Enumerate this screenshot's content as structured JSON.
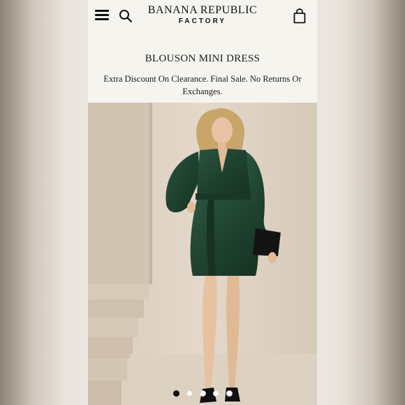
{
  "header": {
    "brand_line1": "BANANA REPUBLIC",
    "brand_line2": "FACTORY",
    "menu_icon": "hamburger-menu-icon",
    "search_icon": "search-icon",
    "bag_icon": "shopping-bag-icon"
  },
  "product": {
    "title": "BLOUSON MINI DRESS",
    "promo": "Extra Discount On Clearance. Final Sale. No Returns Or Exchanges.",
    "dress_color": "#1f4230"
  },
  "carousel": {
    "total": 5,
    "active_index": 0
  },
  "colors": {
    "page_bg": "#f6f4ef",
    "studio_wall": "#e0d4c5",
    "dress": "#1f4230",
    "text": "#1a1a1a"
  }
}
